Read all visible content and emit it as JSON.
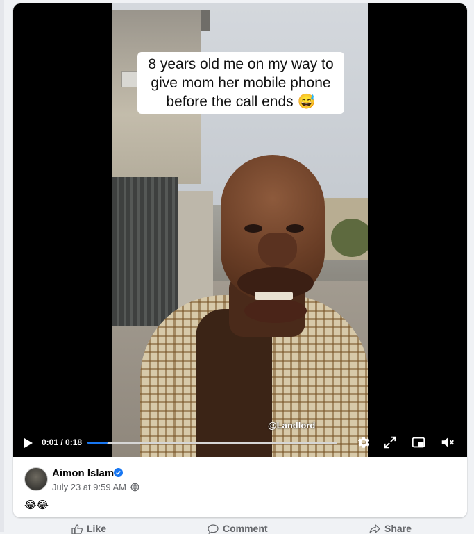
{
  "video": {
    "caption_lines": [
      "8 years old me on my way to",
      "give mom her mobile phone",
      "before the call ends 😅"
    ],
    "watermark": "@Landlord",
    "timecode": "0:01 / 0:18",
    "progress_fraction": 0.08,
    "icons": {
      "play": "play-icon",
      "settings": "gear-icon",
      "fullscreen": "expand-icon",
      "pip": "picture-in-picture-icon",
      "mute": "muted-speaker-icon"
    }
  },
  "post": {
    "author": "Aimon Islam",
    "verified": true,
    "timestamp": "July 23 at 9:59 AM ·",
    "privacy_icon": "globe-icon",
    "text": "😂😂"
  },
  "actions": {
    "like": "Like",
    "comment": "Comment",
    "share": "Share"
  },
  "colors": {
    "accent": "#1877f2",
    "secondary_text": "#65676b",
    "card_bg": "#ffffff",
    "page_bg": "#f0f2f5"
  }
}
